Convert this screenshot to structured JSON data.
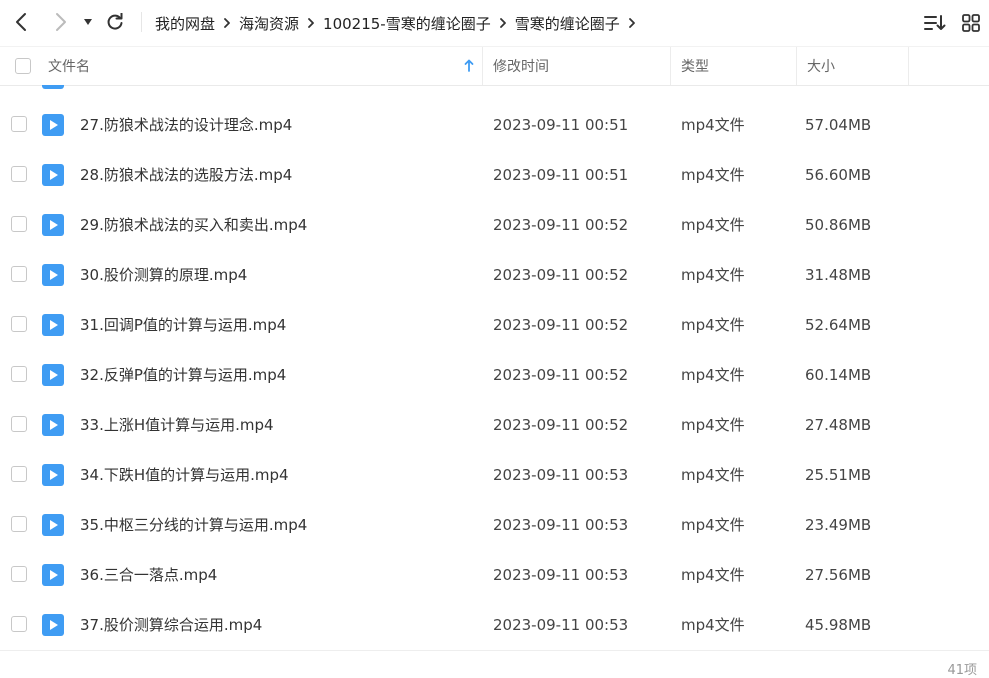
{
  "breadcrumb": [
    "我的网盘",
    "海淘资源",
    "100215-雪寒的缠论圈子",
    "雪寒的缠论圈子"
  ],
  "header": {
    "name_col": "文件名",
    "date_col": "修改时间",
    "type_col": "类型",
    "size_col": "大小"
  },
  "files": [
    {
      "name": "27.防狼术战法的设计理念.mp4",
      "date": "2023-09-11 00:51",
      "type": "mp4文件",
      "size": "57.04MB"
    },
    {
      "name": "28.防狼术战法的选股方法.mp4",
      "date": "2023-09-11 00:51",
      "type": "mp4文件",
      "size": "56.60MB"
    },
    {
      "name": "29.防狼术战法的买入和卖出.mp4",
      "date": "2023-09-11 00:52",
      "type": "mp4文件",
      "size": "50.86MB"
    },
    {
      "name": "30.股价测算的原理.mp4",
      "date": "2023-09-11 00:52",
      "type": "mp4文件",
      "size": "31.48MB"
    },
    {
      "name": "31.回调P值的计算与运用.mp4",
      "date": "2023-09-11 00:52",
      "type": "mp4文件",
      "size": "52.64MB"
    },
    {
      "name": "32.反弹P值的计算与运用.mp4",
      "date": "2023-09-11 00:52",
      "type": "mp4文件",
      "size": "60.14MB"
    },
    {
      "name": "33.上涨H值计算与运用.mp4",
      "date": "2023-09-11 00:52",
      "type": "mp4文件",
      "size": "27.48MB"
    },
    {
      "name": "34.下跌H值的计算与运用.mp4",
      "date": "2023-09-11 00:53",
      "type": "mp4文件",
      "size": "25.51MB"
    },
    {
      "name": "35.中枢三分线的计算与运用.mp4",
      "date": "2023-09-11 00:53",
      "type": "mp4文件",
      "size": "23.49MB"
    },
    {
      "name": "36.三合一落点.mp4",
      "date": "2023-09-11 00:53",
      "type": "mp4文件",
      "size": "27.56MB"
    },
    {
      "name": "37.股价测算综合运用.mp4",
      "date": "2023-09-11 00:53",
      "type": "mp4文件",
      "size": "45.98MB"
    }
  ],
  "footer": {
    "count": "41项"
  },
  "colors": {
    "accent": "#3f9cf3",
    "text": "#333333",
    "muted": "#666666"
  }
}
